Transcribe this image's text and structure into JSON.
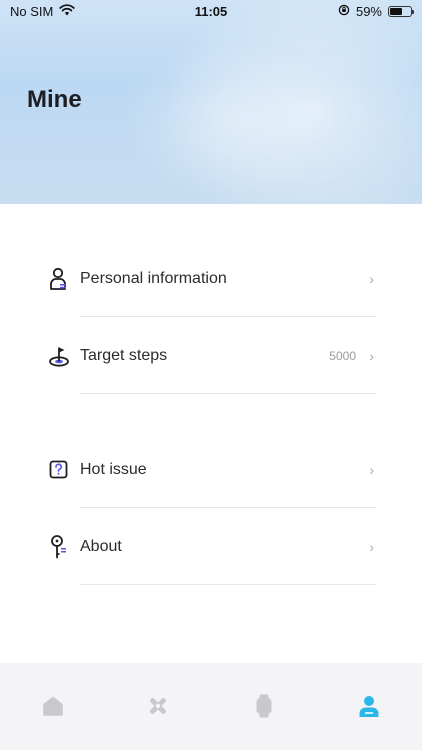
{
  "status_bar": {
    "carrier": "No SIM",
    "time": "11:05",
    "battery_percent": "59%",
    "battery_level": 0.59
  },
  "header": {
    "title": "Mine"
  },
  "menu": {
    "items": [
      {
        "label": "Personal information",
        "value": "",
        "icon": "person-icon"
      },
      {
        "label": "Target steps",
        "value": "5000",
        "icon": "target-flag-icon"
      },
      {
        "label": "Hot issue",
        "value": "",
        "icon": "question-box-icon"
      },
      {
        "label": "About",
        "value": "",
        "icon": "key-info-icon"
      }
    ],
    "chevron": "›"
  },
  "tabbar": {
    "tabs": [
      {
        "icon": "home-icon",
        "active": false
      },
      {
        "icon": "sport-icon",
        "active": false
      },
      {
        "icon": "watch-icon",
        "active": false
      },
      {
        "icon": "profile-icon",
        "active": true
      }
    ],
    "active_color": "#2bb8e8",
    "inactive_color": "#c9c9cd"
  }
}
